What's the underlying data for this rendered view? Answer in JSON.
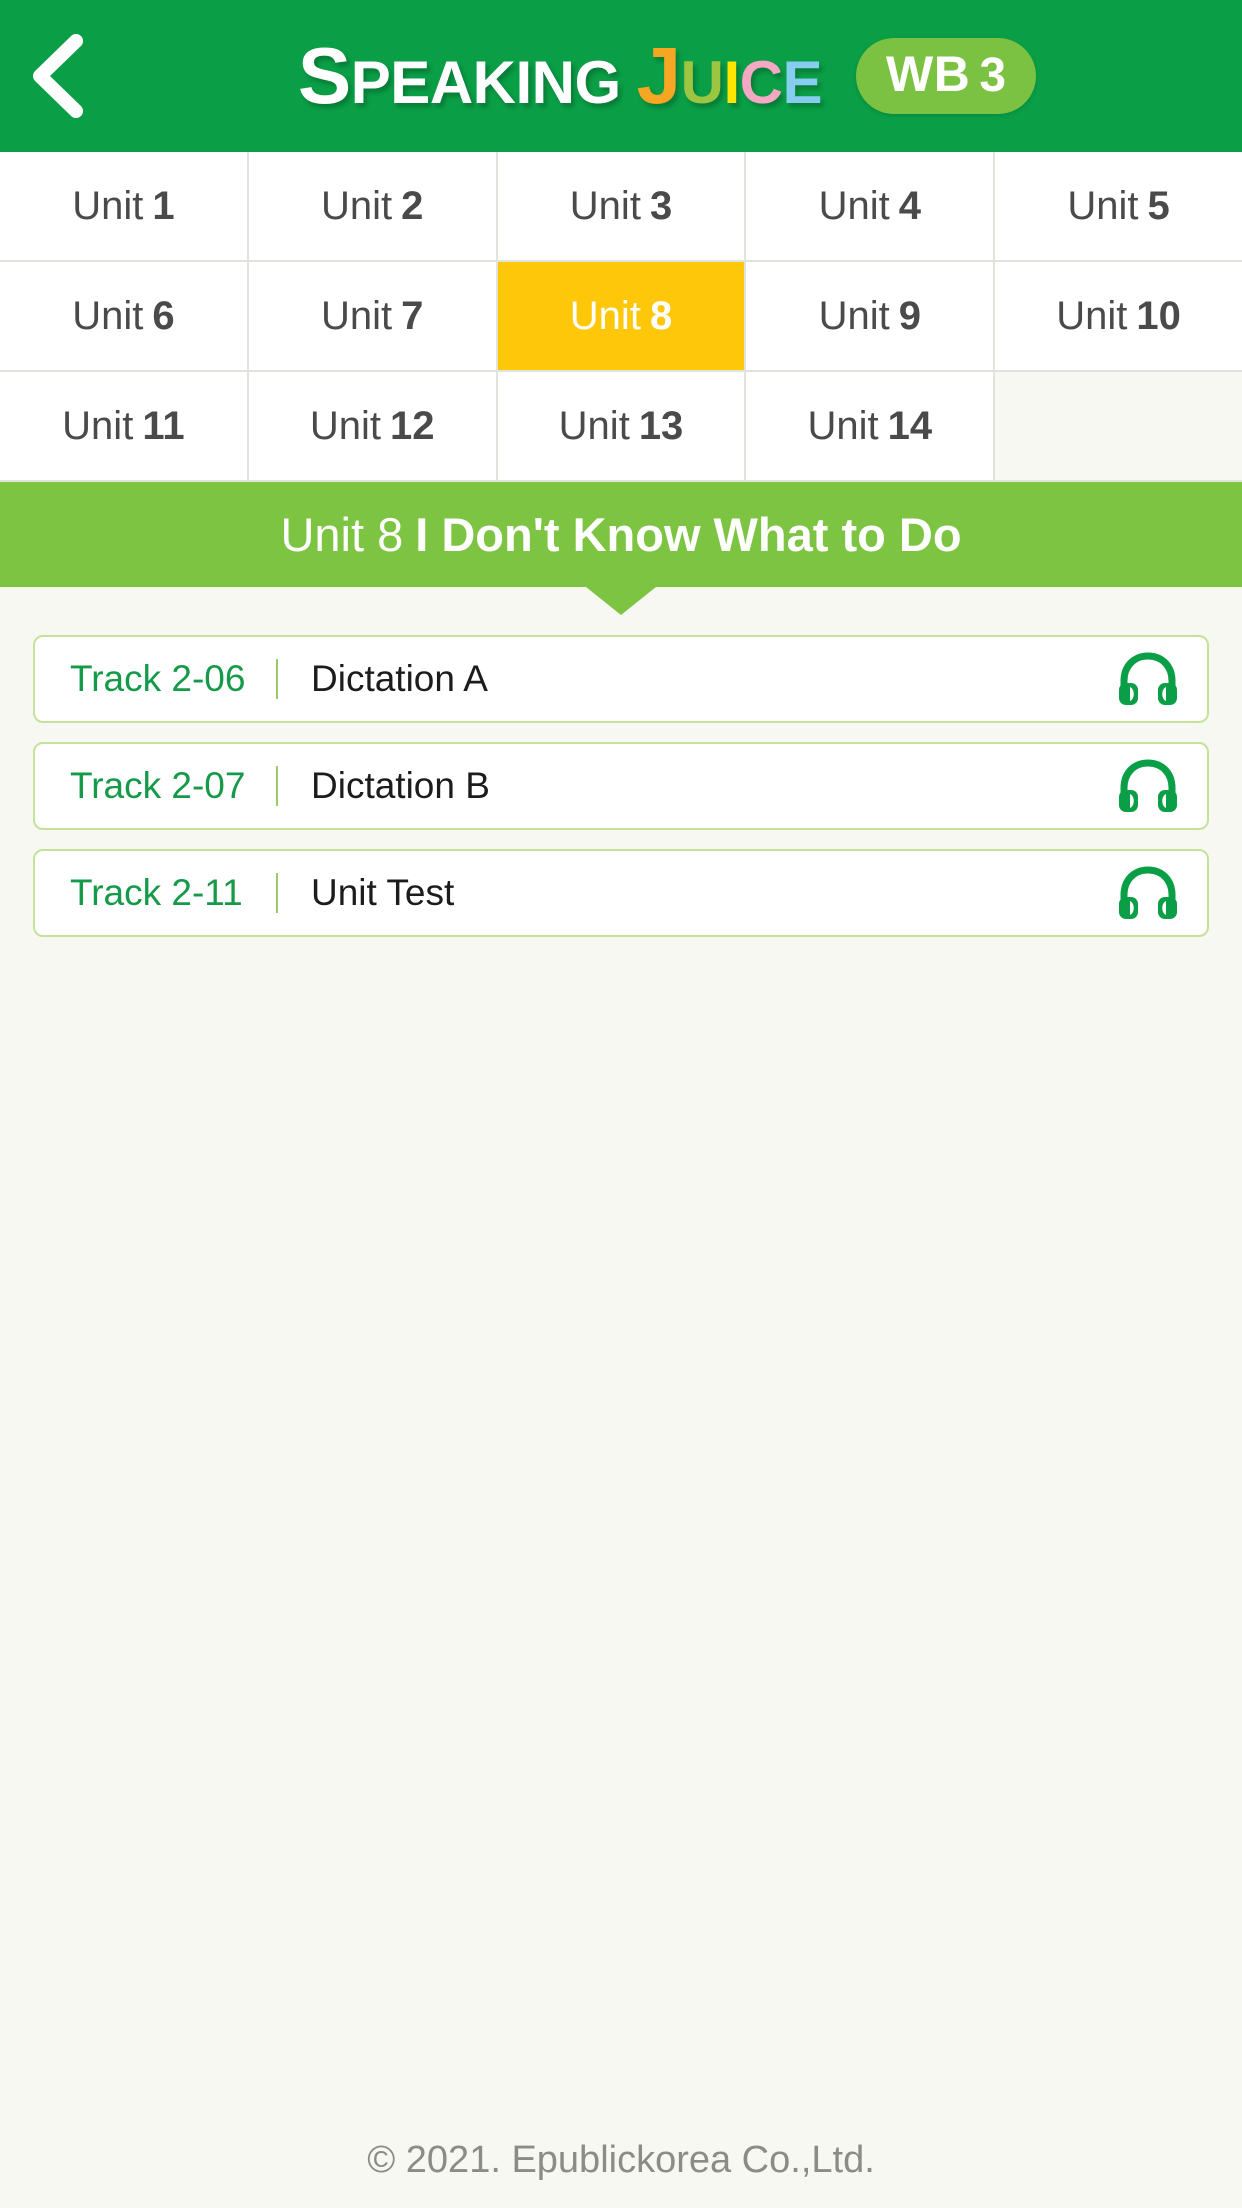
{
  "header": {
    "back_icon": "chevron-left-icon",
    "logo": {
      "word1_cap": "S",
      "word1_rest": "PEAKING",
      "word2": [
        {
          "char": "J",
          "color": "#f5a623"
        },
        {
          "char": "U",
          "color": "#9cc642"
        },
        {
          "char": "I",
          "color": "#ffe600"
        },
        {
          "char": "C",
          "color": "#f4a8c3"
        },
        {
          "char": "E",
          "color": "#87cdf0"
        }
      ]
    },
    "badge": {
      "label": "WB",
      "number": "3"
    },
    "bg_color": "#0a9e46"
  },
  "units": {
    "prefix": "Unit",
    "items": [
      {
        "number": "1",
        "active": false
      },
      {
        "number": "2",
        "active": false
      },
      {
        "number": "3",
        "active": false
      },
      {
        "number": "4",
        "active": false
      },
      {
        "number": "5",
        "active": false
      },
      {
        "number": "6",
        "active": false
      },
      {
        "number": "7",
        "active": false
      },
      {
        "number": "8",
        "active": true
      },
      {
        "number": "9",
        "active": false
      },
      {
        "number": "10",
        "active": false
      },
      {
        "number": "11",
        "active": false
      },
      {
        "number": "12",
        "active": false
      },
      {
        "number": "13",
        "active": false
      },
      {
        "number": "14",
        "active": false
      }
    ],
    "active_color": "#ffc709"
  },
  "banner": {
    "unit_label": "Unit 8",
    "title": "I Don't Know What to Do",
    "bg_color": "#7cc442"
  },
  "tracks": [
    {
      "code": "Track 2-06",
      "name": "Dictation A",
      "icon": "headphones-icon"
    },
    {
      "code": "Track 2-07",
      "name": "Dictation B",
      "icon": "headphones-icon"
    },
    {
      "code": "Track 2-11",
      "name": "Unit Test",
      "icon": "headphones-icon"
    }
  ],
  "footer": {
    "copyright": "© 2021. Epublickorea Co.,Ltd."
  }
}
